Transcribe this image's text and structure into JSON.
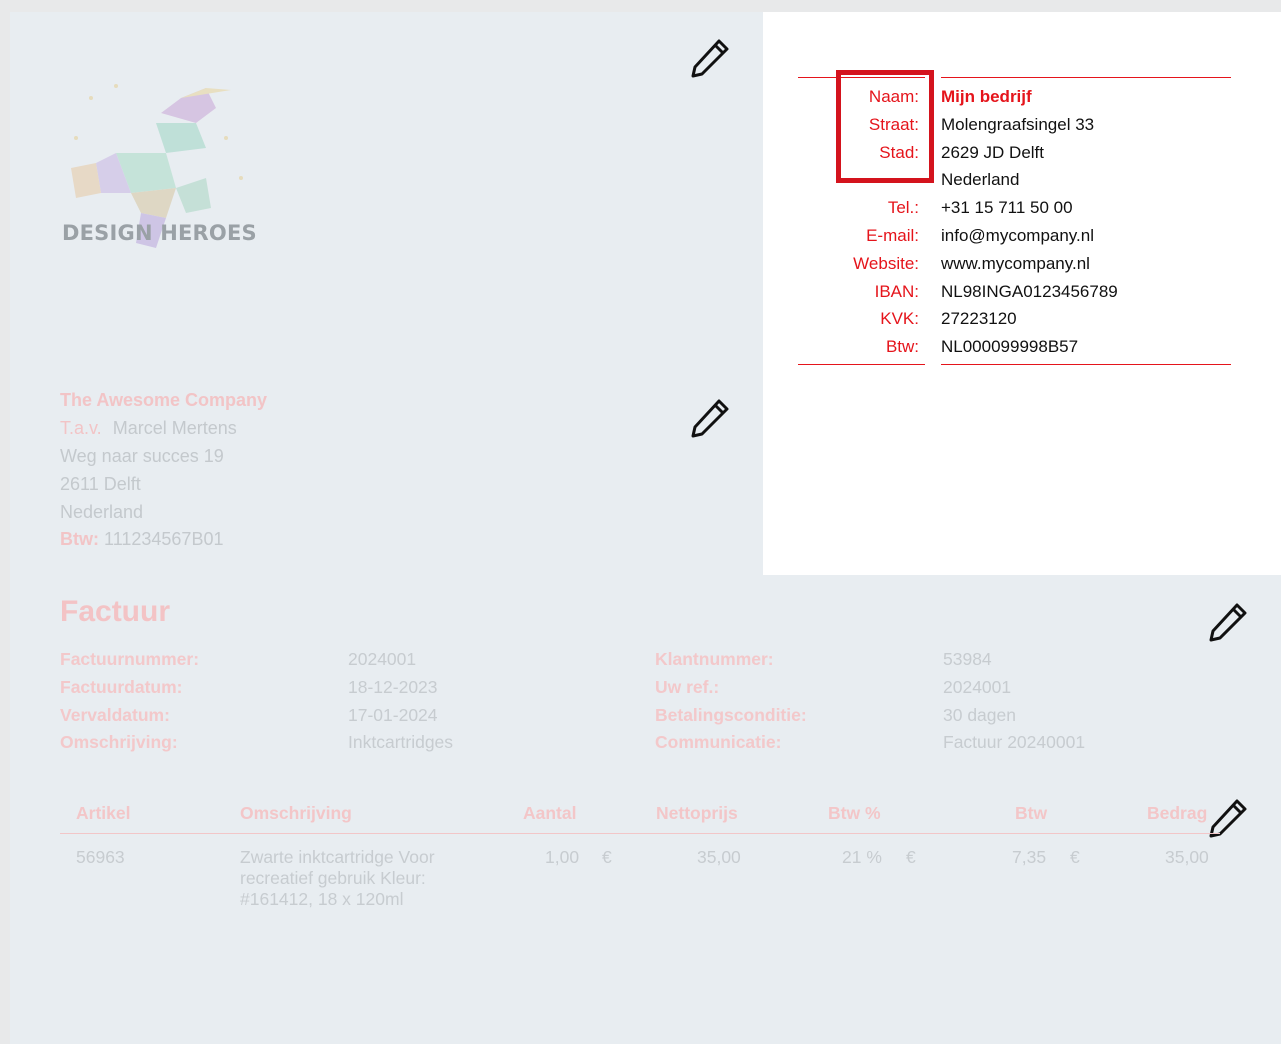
{
  "logo": {
    "text": "DESIGN HEROES",
    "icon": "unicorn-logo-icon"
  },
  "company": {
    "rows": [
      {
        "label": "Naam:",
        "value": "Mijn bedrijf"
      },
      {
        "label": "Straat:",
        "value": "Molengraafsingel 33"
      },
      {
        "label": "Stad:",
        "value": "2629 JD Delft"
      },
      {
        "label": "",
        "value": "Nederland"
      },
      {
        "label": "Tel.:",
        "value": "+31 15 711 50 00"
      },
      {
        "label": "E-mail:",
        "value": "info@mycompany.nl"
      },
      {
        "label": "Website:",
        "value": "www.mycompany.nl"
      },
      {
        "label": "IBAN:",
        "value": "NL98INGA0123456789"
      },
      {
        "label": "KVK:",
        "value": "27223120"
      },
      {
        "label": "Btw:",
        "value": "NL000099998B57"
      }
    ]
  },
  "customer": {
    "name": "The Awesome Company",
    "attn_label": "T.a.v.",
    "attn_value": "Marcel Mertens",
    "street": "Weg naar succes 19",
    "city": "2611 Delft",
    "country": "Nederland",
    "vat_label": "Btw:",
    "vat_value": "111234567B01"
  },
  "invoice": {
    "title": "Factuur",
    "left": [
      {
        "label": "Factuurnummer:",
        "value": "2024001"
      },
      {
        "label": "Factuurdatum:",
        "value": "18-12-2023"
      },
      {
        "label": "Vervaldatum:",
        "value": "17-01-2024"
      },
      {
        "label": "Omschrijving:",
        "value": "Inktcartridges"
      }
    ],
    "right": [
      {
        "label": "Klantnummer:",
        "value": "53984"
      },
      {
        "label": "Uw ref.:",
        "value": "2024001"
      },
      {
        "label": "Betalingsconditie:",
        "value": "30 dagen"
      },
      {
        "label": "Communicatie:",
        "value": "Factuur 20240001"
      }
    ]
  },
  "table": {
    "headers": [
      "Artikel",
      "Omschrijving",
      "Aantal",
      "Nettoprijs",
      "Btw %",
      "Btw",
      "Bedrag"
    ],
    "rows": [
      {
        "artikel": "56963",
        "omschrijving": "Zwarte inktcartridge Voor recreatief gebruik Kleur: #161412, 18 x 120ml",
        "aantal": "1,00",
        "currency1": "€",
        "nettoprijs": "35,00",
        "btw_pct": "21 %",
        "currency2": "€",
        "btw": "7,35",
        "currency3": "€",
        "bedrag": "35,00"
      }
    ]
  },
  "colors": {
    "accent": "#e5141b",
    "highlight": "#d4131d",
    "canvas": "#e8edf1"
  }
}
